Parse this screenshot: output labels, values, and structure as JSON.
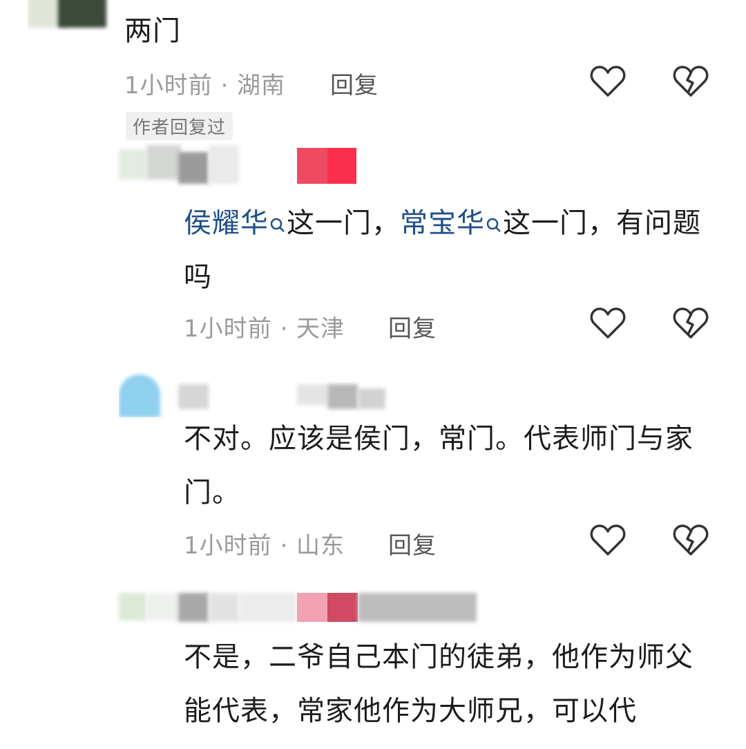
{
  "comments": [
    {
      "text": "两门",
      "time_location": "1小时前 · 湖南",
      "reply_label": "回复",
      "badge": "作者回复过"
    },
    {
      "segments": [
        {
          "text": "侯耀华",
          "mention": true
        },
        {
          "text": "这一门，",
          "mention": false
        },
        {
          "text": "常宝华",
          "mention": true
        },
        {
          "text": "这一门，有问题吗",
          "mention": false
        }
      ],
      "time_location": "1小时前 · 天津",
      "reply_label": "回复"
    },
    {
      "text": "不对。应该是侯门，常门。代表师门与家门。",
      "time_location": "1小时前 · 山东",
      "reply_label": "回复"
    },
    {
      "text": "不是，二爷自己本门的徒弟，他作为师父能代表，常家他作为大师兄，可以代"
    }
  ],
  "colors": {
    "mention": "#1f4f87",
    "meta": "#9a9a9a",
    "badge_bg": "#f0f0f0"
  },
  "icons": [
    "heart-outline-icon",
    "broken-heart-icon",
    "search-mini-icon"
  ]
}
